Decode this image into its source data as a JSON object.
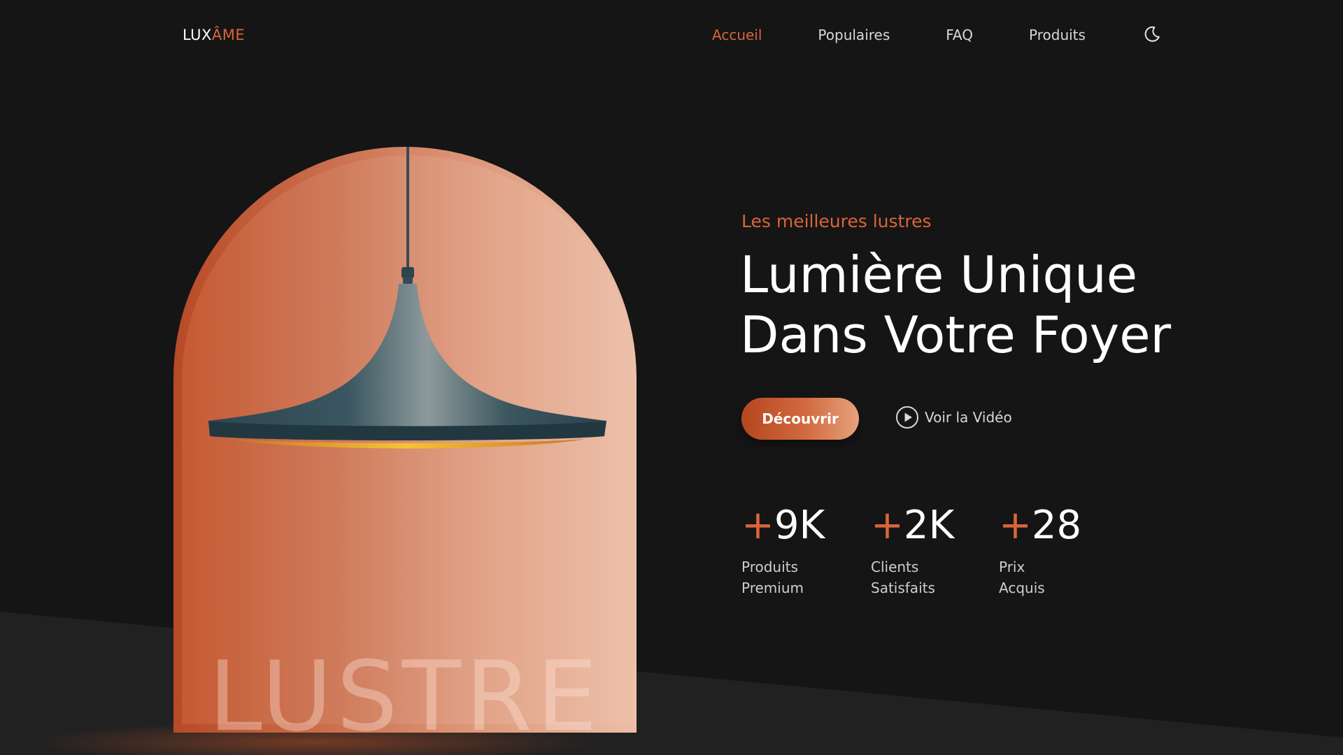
{
  "colors": {
    "accent": "#d8653a",
    "background": "#151515",
    "background_wedge": "#212121"
  },
  "brand": {
    "lux": "LUX",
    "ame": "ÂME"
  },
  "nav": {
    "items": [
      {
        "label": "Accueil",
        "active": true
      },
      {
        "label": "Populaires",
        "active": false
      },
      {
        "label": "FAQ",
        "active": false
      },
      {
        "label": "Produits",
        "active": false
      }
    ],
    "theme_toggle_icon": "moon-icon"
  },
  "hero": {
    "image_caption": "LUSTRE",
    "eyebrow": "Les meilleures lustres",
    "headline_line1": "Lumière Unique",
    "headline_line2": "Dans Votre Foyer",
    "primary_button": "Découvrir",
    "video_button": "Voir la Vidéo",
    "video_icon": "play-circle-icon"
  },
  "stats": [
    {
      "plus": "+",
      "value": "9K",
      "line1": "Produits",
      "line2": "Premium"
    },
    {
      "plus": "+",
      "value": "2K",
      "line1": "Clients",
      "line2": "Satisfaits"
    },
    {
      "plus": "+",
      "value": "28",
      "line1": "Prix",
      "line2": "Acquis"
    }
  ]
}
